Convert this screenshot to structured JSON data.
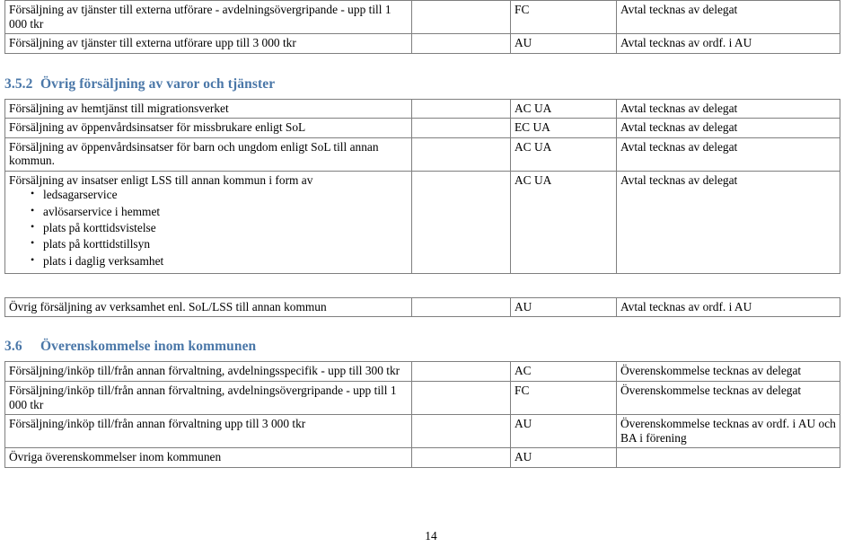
{
  "document": {
    "page_number": "14",
    "heading_color": "#4a77a8"
  },
  "table_top": {
    "rows": [
      {
        "activity": "Försäljning av tjänster till externa utförare - avdelningsövergripande - upp till 1 000 tkr",
        "blank": "",
        "code": "FC",
        "note": "Avtal tecknas av delegat"
      },
      {
        "activity": "Försäljning av tjänster till externa utförare upp till 3 000 tkr",
        "blank": "",
        "code": "AU",
        "note": "Avtal tecknas av ordf. i AU"
      }
    ]
  },
  "section_352": {
    "number": "3.5.2",
    "title": "Övrig försäljning av varor och tjänster",
    "rows": [
      {
        "activity": "Försäljning av hemtjänst till migrationsverket",
        "blank": "",
        "code": "AC UA",
        "note": "Avtal tecknas av delegat"
      },
      {
        "activity": "Försäljning av öppenvårdsinsatser för missbrukare enligt SoL",
        "blank": "",
        "code": "EC UA",
        "note": "Avtal tecknas av delegat"
      },
      {
        "activity": "Försäljning av öppenvårdsinsatser för barn och ungdom enligt SoL till annan kommun.",
        "blank": "",
        "code": "AC UA",
        "note": "Avtal tecknas av delegat"
      },
      {
        "activity": "Försäljning av insatser enligt LSS till annan kommun i form av",
        "bullets": [
          "ledsagarservice",
          "avlösarservice i hemmet",
          "plats på korttidsvistelse",
          "plats på korttidstillsyn",
          "plats i daglig verksamhet"
        ],
        "blank": "",
        "code": "AC UA",
        "note": "Avtal tecknas av delegat"
      }
    ]
  },
  "table_mid": {
    "rows": [
      {
        "activity": "Övrig försäljning av verksamhet enl. SoL/LSS till annan kommun",
        "blank": "",
        "code": "AU",
        "note": "Avtal tecknas av ordf. i AU"
      }
    ]
  },
  "section_36": {
    "number": "3.6",
    "title": "Överenskommelse inom kommunen",
    "rows": [
      {
        "activity": "Försäljning/inköp till/från annan förvaltning, avdelningsspecifik - upp till 300 tkr",
        "blank": "",
        "code": "AC",
        "note": "Överenskommelse tecknas av delegat"
      },
      {
        "activity": "Försäljning/inköp till/från annan förvaltning, avdelningsövergripande - upp till 1 000 tkr",
        "blank": "",
        "code": "FC",
        "note": "Överenskommelse tecknas av delegat"
      },
      {
        "activity": "Försäljning/inköp till/från annan förvaltning upp till 3 000 tkr",
        "blank": "",
        "code": "AU",
        "note": "Överenskommelse tecknas av ordf. i AU och BA i förening"
      },
      {
        "activity": "Övriga överenskommelser inom kommunen",
        "blank": "",
        "code": "AU",
        "note": ""
      }
    ]
  }
}
